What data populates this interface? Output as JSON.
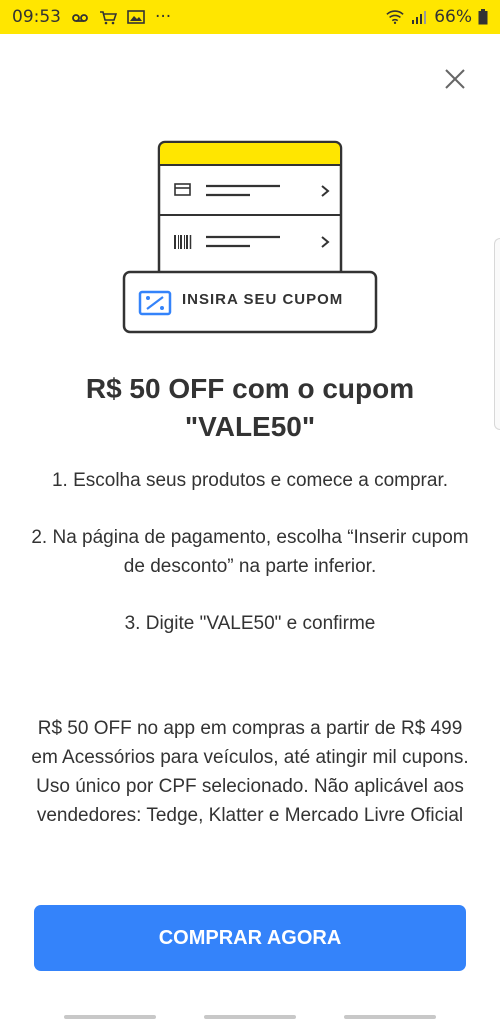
{
  "status_bar": {
    "time": "09:53",
    "dots": "···",
    "battery": "66%"
  },
  "illustration": {
    "coupon_label": "INSIRA SEU CUPOM",
    "accent_color": "#ffe600",
    "coupon_icon_color": "#3483fa"
  },
  "title": {
    "line1": "R$ 50 OFF com o cupom",
    "line2": "\"VALE50\""
  },
  "steps": [
    "1. Escolha seus produtos e comece a comprar.",
    "2. Na página de pagamento, escolha “Inserir cupom de desconto” na parte inferior.",
    "3. Digite \"VALE50\" e confirme"
  ],
  "terms": "R$ 50 OFF no app em compras a partir de R$ 499 em Acessórios para veículos, até atingir mil cupons. Uso único por CPF selecionado. Não aplicável aos vendedores: Tedge, Klatter e Mercado Livre Oficial",
  "cta": {
    "label": "COMPRAR AGORA",
    "color": "#3483fa"
  },
  "colors": {
    "status_bar_bg": "#ffe600",
    "text": "#333333"
  }
}
